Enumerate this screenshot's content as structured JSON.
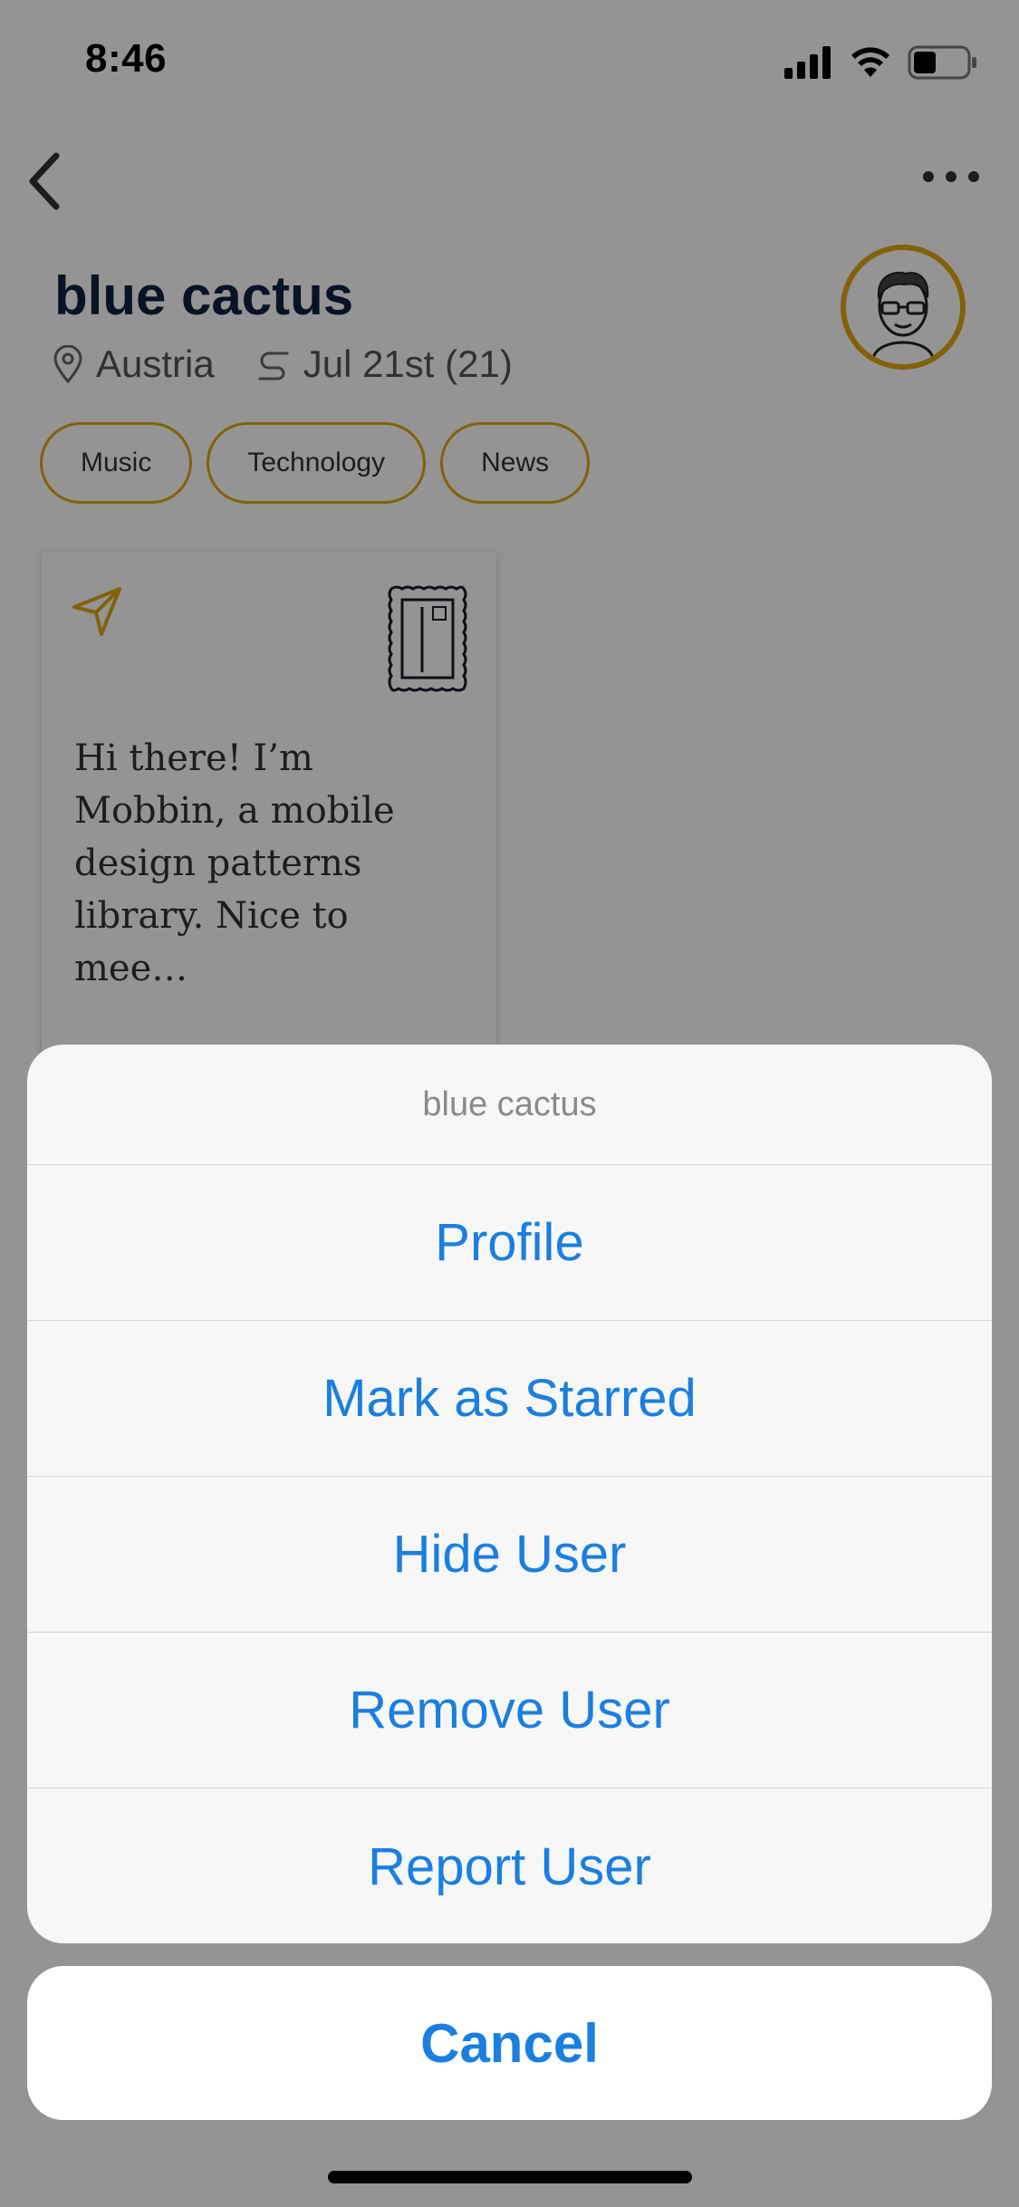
{
  "status_bar": {
    "time": "8:46"
  },
  "profile": {
    "name": "blue cactus",
    "location": "Austria",
    "date": "Jul 21st (21)",
    "tags": [
      "Music",
      "Technology",
      "News"
    ]
  },
  "card": {
    "message": "Hi there! I’m Mobbin, a mobile design patterns library. Nice to mee…"
  },
  "action_sheet": {
    "title": "blue cactus",
    "actions": [
      "Profile",
      "Mark as Starred",
      "Hide User",
      "Remove User",
      "Report User"
    ],
    "cancel": "Cancel"
  },
  "colors": {
    "accent": "#e3a711",
    "action_blue": "#1a7fe0",
    "title_navy": "#0f2240"
  }
}
